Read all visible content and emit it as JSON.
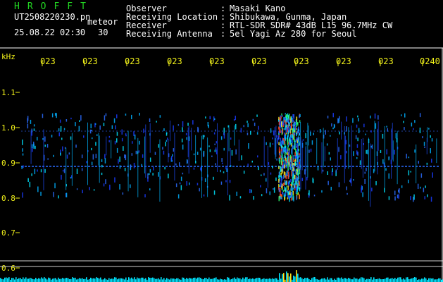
{
  "header": {
    "app_title": "HROFFT",
    "filename": "UT2508220230.pn",
    "mode": "meteor",
    "timestamp": "25.08.22 02:30",
    "duration": "30",
    "info": [
      {
        "label": "Observer",
        "sep": ":",
        "value": "Masaki Kano"
      },
      {
        "label": "Receiving Location",
        "sep": ":",
        "value": "Shibukawa, Gunma, Japan"
      },
      {
        "label": "Receiver",
        "sep": ":",
        "value": "RTL-SDR SDR# 43dB L15 96.7MHz CW"
      },
      {
        "label": "Receiving Antenna",
        "sep": ":",
        "value": "5el Yagi Az 280 for Seoul"
      }
    ]
  },
  "axes": {
    "y_unit": "kHz",
    "y_ticks": [
      "1.1",
      "1.0",
      "0.9",
      "0.8",
      "0.7",
      "0.6"
    ],
    "x_ticks": [
      "023",
      "023",
      "023",
      "023",
      "023",
      "023",
      "023",
      "023",
      "023",
      "0240"
    ]
  },
  "colors": {
    "background": "#000000",
    "labels": "#f2f21a",
    "title": "#22d622",
    "text": "#ffffff",
    "baseline": "#2a6cff",
    "spectrum": "#00e5ff"
  }
}
